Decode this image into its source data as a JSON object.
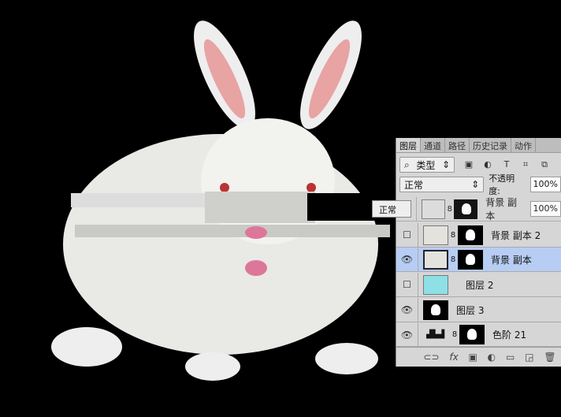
{
  "panel": {
    "tabs": [
      "图层",
      "通道",
      "路径",
      "历史记录",
      "动作"
    ],
    "filter": {
      "label": "类型",
      "icons": [
        "image-filter-icon",
        "adjustment-filter-icon",
        "type-filter-icon",
        "shape-filter-icon",
        "smart-object-filter-icon"
      ]
    },
    "blend_mode": "正常",
    "opacity_label": "不透明度:",
    "opacity_value": "100%",
    "fill_value": "100%",
    "floating_blend": "正常",
    "layers": [
      {
        "name": "背景 副本",
        "visible": true,
        "glitched": true
      },
      {
        "name": "背景 副本 2",
        "visible": false
      },
      {
        "name": "背景 副本",
        "visible": true,
        "selected": true
      },
      {
        "name": "图层 2",
        "visible": false
      },
      {
        "name": "图层 3",
        "visible": true
      },
      {
        "name": "色阶 21",
        "visible": true
      }
    ],
    "bottom_icons": [
      "link-icon",
      "fx-icon",
      "mask-icon",
      "adjustment-icon",
      "folder-icon",
      "new-layer-icon",
      "trash-icon"
    ],
    "colors": {
      "selected": "#b7cdf3",
      "layer2_fill": "#8ee0e6"
    }
  }
}
